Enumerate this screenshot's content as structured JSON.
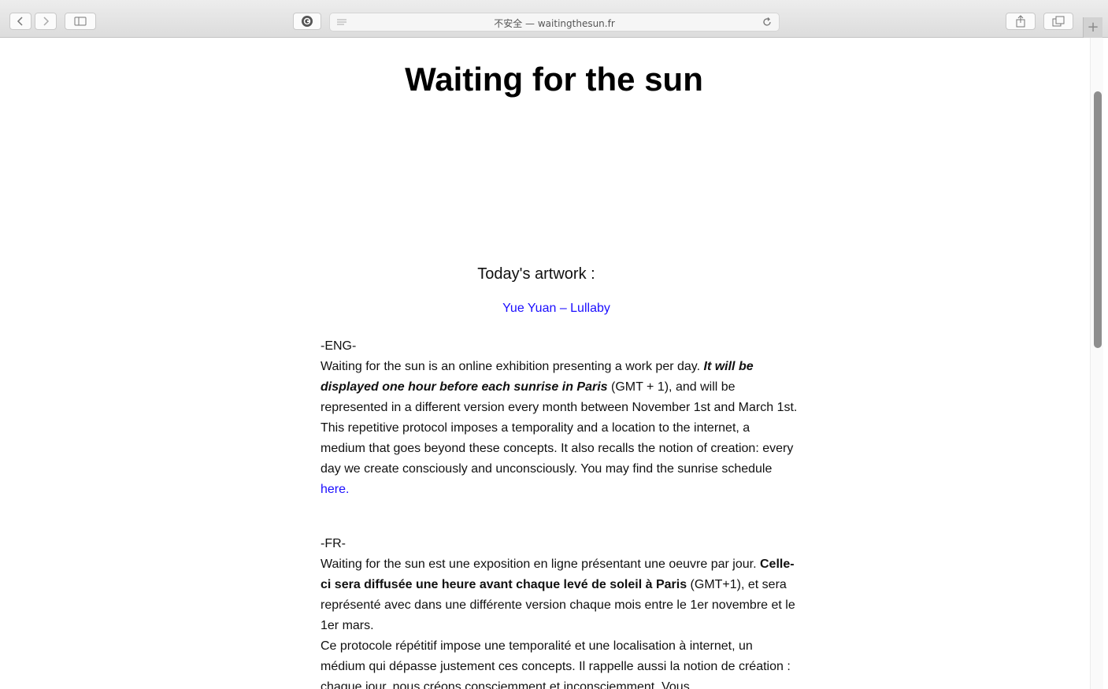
{
  "browser": {
    "address": "不安全 — waitingthesun.fr",
    "new_tab_label": "+",
    "icons": {
      "back": "chevron-left-icon",
      "forward": "chevron-right-icon",
      "sidebar": "sidebar-icon",
      "extension": "extension-icon",
      "reader": "reader-icon",
      "reload": "reload-icon",
      "share": "share-icon",
      "tabs": "tabs-overview-icon"
    }
  },
  "page": {
    "title": "Waiting for the sun",
    "today_label": "Today's artwork :",
    "artwork_link": "Yue Yuan – Lullaby",
    "eng": {
      "tag": "-ENG-",
      "p1_a": "Waiting for the sun is an online exhibition presenting a work per day. ",
      "p1_b": "It will be displayed one hour before each sunrise in Paris",
      "p1_c": " (GMT + 1), and will be represented in a different version every month between November 1st and March 1st.",
      "p2_a": "This repetitive protocol imposes a temporality and a location to the internet, a medium that goes beyond these concepts. It also recalls the notion of creation: every day we create consciously and unconsciously. You may find the sunrise schedule ",
      "p2_link": "here."
    },
    "fr": {
      "tag": "-FR-",
      "p1_a": "Waiting for the sun est une exposition en ligne présentant une oeuvre par jour. ",
      "p1_b": "Celle-ci sera diffusée une heure avant chaque levé de soleil à Paris",
      "p1_c": " (GMT+1), et sera représenté avec dans une différente version chaque mois entre le 1er novembre et le 1er mars.",
      "p2_a": "Ce protocole répétitif impose une temporalité et une localisation à internet, un médium qui dépasse justement ces concepts. Il rappelle aussi la notion de création : chaque jour, nous créons consciemment et inconsciemment. Vous"
    }
  }
}
